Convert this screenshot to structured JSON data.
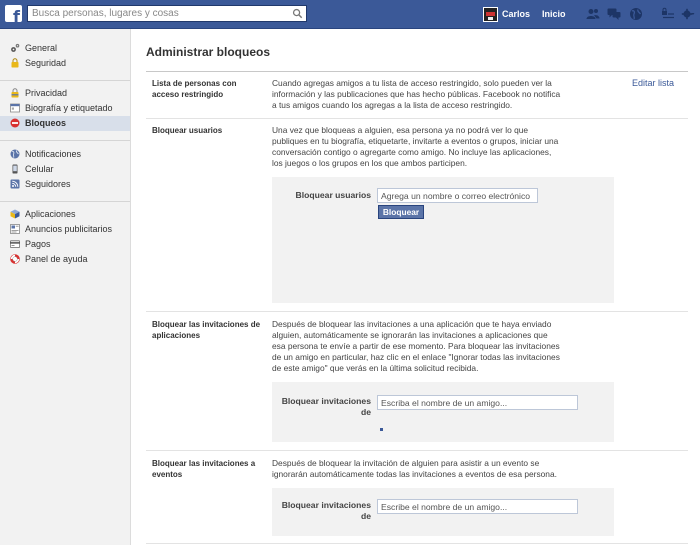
{
  "topbar": {
    "logo": "f",
    "search_placeholder": "Busca personas, lugares y cosas",
    "user_name": "Carlos",
    "home_label": "Inicio"
  },
  "sidebar": {
    "group1": [
      {
        "label": "General",
        "icon": "gear-icon"
      },
      {
        "label": "Seguridad",
        "icon": "lock-icon"
      }
    ],
    "group2": [
      {
        "label": "Privacidad",
        "icon": "privacy-lock-icon"
      },
      {
        "label": "Biografía y etiquetado",
        "icon": "timeline-icon"
      },
      {
        "label": "Bloqueos",
        "icon": "block-icon",
        "active": true
      }
    ],
    "group3": [
      {
        "label": "Notificaciones",
        "icon": "globe-icon"
      },
      {
        "label": "Celular",
        "icon": "mobile-icon"
      },
      {
        "label": "Seguidores",
        "icon": "rss-icon"
      }
    ],
    "group4": [
      {
        "label": "Aplicaciones",
        "icon": "cube-icon"
      },
      {
        "label": "Anuncios publicitarios",
        "icon": "ads-icon"
      },
      {
        "label": "Pagos",
        "icon": "card-icon"
      },
      {
        "label": "Panel de ayuda",
        "icon": "lifebuoy-icon"
      }
    ]
  },
  "main": {
    "title": "Administrar bloqueos",
    "restricted": {
      "title": "Lista de personas con acceso restringido",
      "description": "Cuando agregas amigos a tu lista de acceso restringido, solo pueden ver la información y las publicaciones que has hecho públicas. Facebook no notifica a tus amigos cuando los agregas a la lista de acceso restringido.",
      "edit_link": "Editar lista"
    },
    "block_users": {
      "title": "Bloquear usuarios",
      "description": "Una vez que bloqueas a alguien, esa persona ya no podrá ver lo que publiques en tu biografía, etiquetarte, invitarte a eventos o grupos, iniciar una conversación contigo o agregarte como amigo. No incluye las aplicaciones, los juegos o los grupos en los que ambos participen.",
      "field_label": "Bloquear usuarios",
      "input_placeholder": "Agrega un nombre o correo electrónico",
      "button_label": "Bloquear"
    },
    "block_app_invites": {
      "title": "Bloquear las invitaciones de aplicaciones",
      "description": "Después de bloquear las invitaciones a una aplicación que te haya enviado alguien, automáticamente se ignorarán las invitaciones a aplicaciones que esa persona te envíe a partir de ese momento. Para bloquear las invitaciones de un amigo en particular, haz clic en el enlace \"Ignorar todas las invitaciones de este amigo\" que verás en la última solicitud recibida.",
      "field_label": "Bloquear invitaciones de",
      "input_placeholder": "Escriba el nombre de un amigo..."
    },
    "block_event_invites": {
      "title": "Bloquear las invitaciones a eventos",
      "description": "Después de bloquear la invitación de alguien para asistir a un evento se ignorarán automáticamente todas las invitaciones a eventos de esa persona.",
      "field_label": "Bloquear invitaciones de",
      "input_placeholder": "Escribe el nombre de un amigo..."
    }
  },
  "colors": {
    "brand": "#3b5998",
    "sidebar_bg": "#f2f2f2",
    "active_item_bg": "#d8dfea",
    "link": "#3b5998"
  }
}
